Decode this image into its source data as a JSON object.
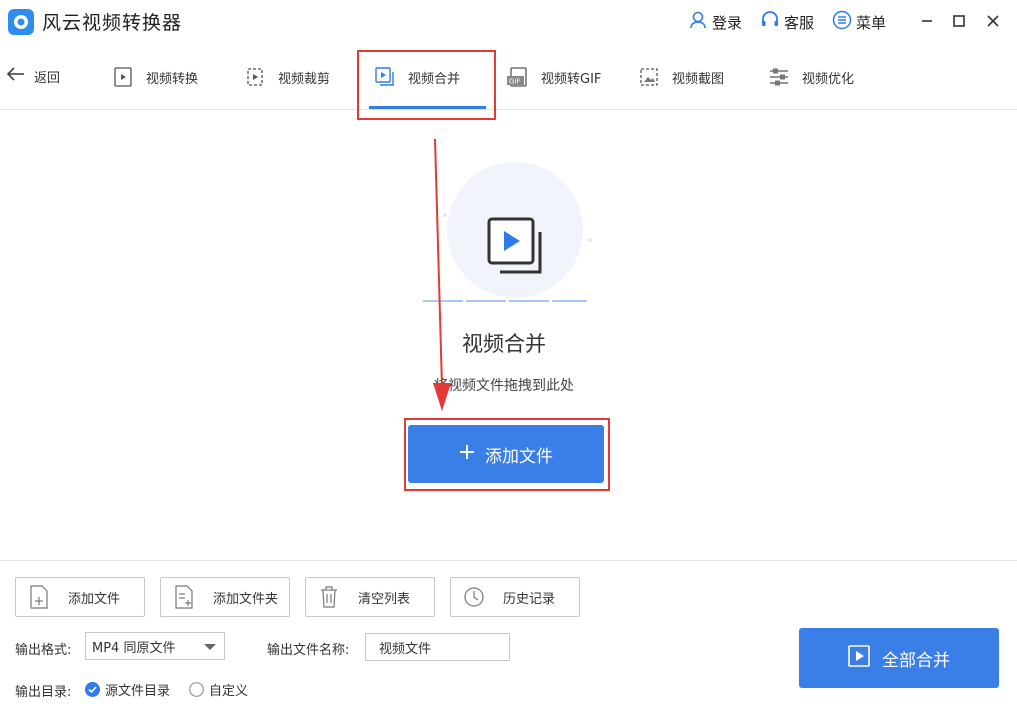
{
  "app": {
    "title": "风云视频转换器",
    "logo_icon": "app-logo-icon"
  },
  "top_actions": {
    "login": "登录",
    "service": "客服",
    "menu": "菜单"
  },
  "nav": {
    "back": "返回",
    "tabs": [
      {
        "label": "视频转换",
        "icon": "video-convert-icon"
      },
      {
        "label": "视频裁剪",
        "icon": "video-crop-icon"
      },
      {
        "label": "视频合并",
        "icon": "video-merge-icon",
        "active": true
      },
      {
        "label": "视频转GIF",
        "icon": "gif-icon"
      },
      {
        "label": "视频截图",
        "icon": "screenshot-icon"
      },
      {
        "label": "视频优化",
        "icon": "optimize-icon"
      }
    ]
  },
  "dropzone": {
    "title": "视频合并",
    "subtitle": "将视频文件拖拽到此处",
    "add_button": "添加文件"
  },
  "toolbar": {
    "add_file": "添加文件",
    "add_folder": "添加文件夹",
    "clear_list": "清空列表",
    "history": "历史记录"
  },
  "output": {
    "format_label": "输出格式:",
    "format_value": "MP4 同原文件",
    "name_label": "输出文件名称:",
    "name_value": "视频文件",
    "dir_label": "输出目录:",
    "dir_options": [
      "源文件目录",
      "自定义"
    ],
    "dir_selected": "源文件目录"
  },
  "merge_all": "全部合并",
  "colors": {
    "accent": "#3a7fe8",
    "highlight": "#e53935"
  }
}
